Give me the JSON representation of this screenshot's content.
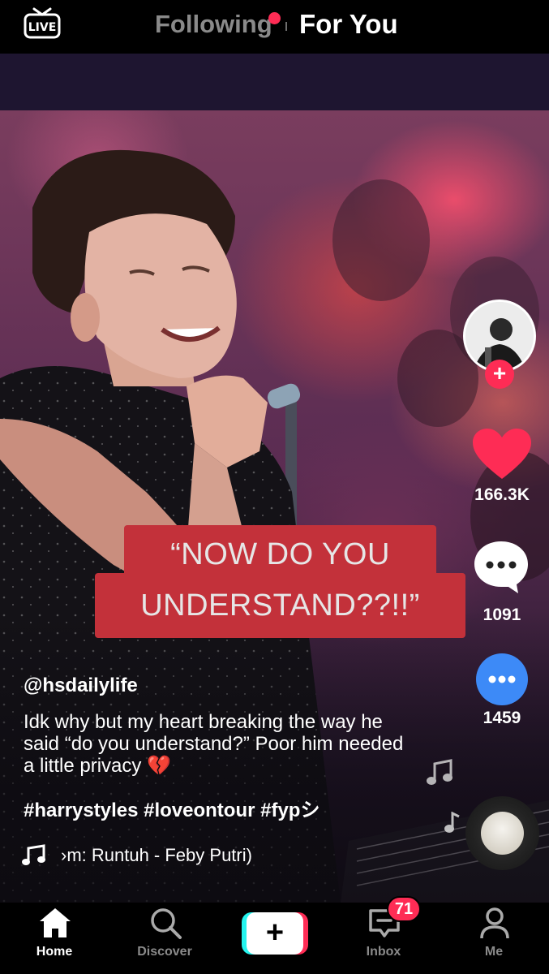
{
  "top_bar": {
    "live_label": "LIVE",
    "tabs": [
      {
        "label": "Following",
        "active": false,
        "has_dot": true
      },
      {
        "label": "For You",
        "active": true
      }
    ]
  },
  "video": {
    "caption_overlay": {
      "line1": "“NOW DO YOU",
      "line2": "UNDERSTAND??!!”"
    }
  },
  "actions": {
    "follow_icon": "plus-icon",
    "likes": "166.3K",
    "comments": "1091",
    "shares": "1459"
  },
  "post": {
    "username": "@hsdailylife",
    "description": "Idk why but my heart breaking the way he said “do you understand?” Poor him needed a little privacy 💔",
    "hashtags": "#harrystyles #loveontour #fypシ",
    "sound": "›m: Runtuh - Feby Putri)"
  },
  "bottom_nav": {
    "items": [
      {
        "label": "Home",
        "icon": "home-icon",
        "active": true
      },
      {
        "label": "Discover",
        "icon": "search-icon",
        "active": false
      },
      {
        "label": "",
        "icon": "create-plus-icon",
        "active": false
      },
      {
        "label": "Inbox",
        "icon": "inbox-icon",
        "active": false,
        "badge": "71"
      },
      {
        "label": "Me",
        "icon": "profile-icon",
        "active": false
      }
    ]
  },
  "colors": {
    "accent": "#fe2c55",
    "cyan": "#25f4ee",
    "share_blue": "#3d8af7",
    "caption_red": "#c3313a"
  }
}
